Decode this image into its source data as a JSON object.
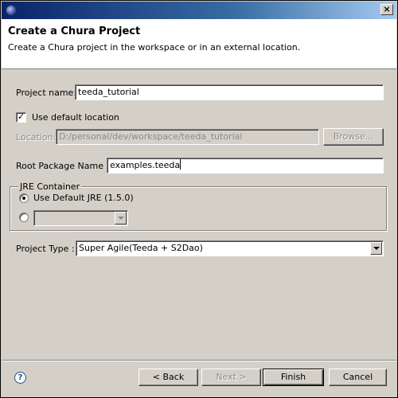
{
  "window": {
    "title": "",
    "close_glyph": "×"
  },
  "banner": {
    "title": "Create a Chura Project",
    "description": "Create a Chura project in the workspace or in an external location."
  },
  "form": {
    "project_name_label": "Project name:",
    "project_name_value": "teeda_tutorial",
    "use_default_location_label": "Use default location",
    "use_default_location_checked": true,
    "location_label": "Location:",
    "location_value": "D:/personal/dev/workspace/teeda_tutorial",
    "browse_label": "Browse...",
    "root_package_label": "Root Package Name :",
    "root_package_value": "examples.teeda",
    "jre": {
      "group_title": "JRE Container",
      "default_option_label": "Use Default JRE (1.5.0)",
      "selected": "default",
      "alt_option_value": ""
    },
    "project_type_label": "Project Type :",
    "project_type_value": "Super Agile(Teeda + S2Dao)"
  },
  "footer": {
    "help_glyph": "?",
    "back_label": "< Back",
    "next_label": "Next >",
    "finish_label": "Finish",
    "cancel_label": "Cancel"
  }
}
